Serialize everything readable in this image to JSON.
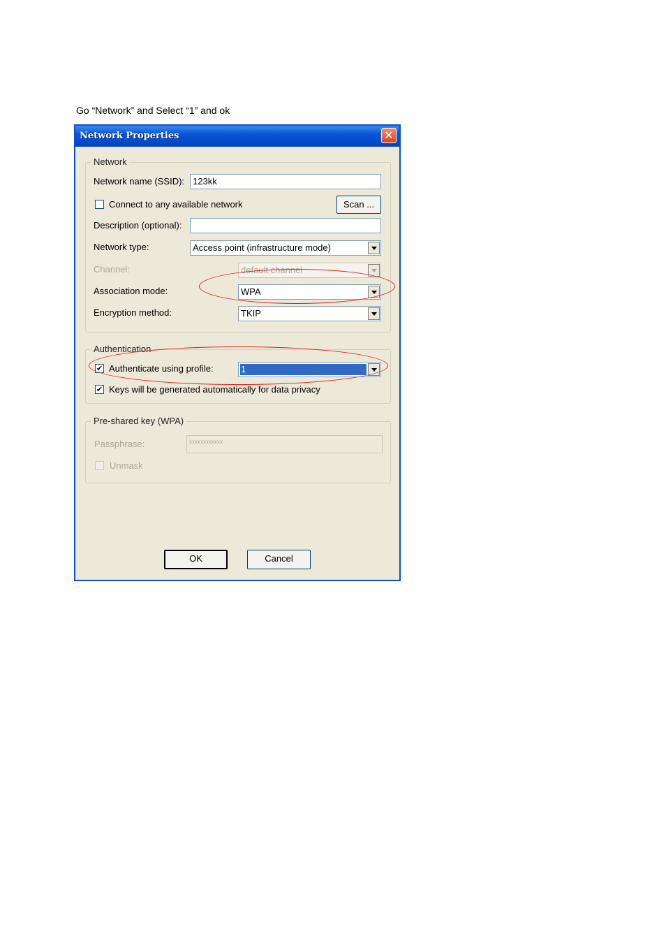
{
  "caption": "Go “Network” and Select “1” and ok",
  "dialog": {
    "title": "Network Properties",
    "close_icon": "close-icon"
  },
  "network_group": {
    "legend": "Network",
    "ssid_label": "Network name (SSID):",
    "ssid_value": "123kk",
    "connect_any_label": "Connect to any available network",
    "connect_any_checked": false,
    "scan_button": "Scan ...",
    "description_label": "Description (optional):",
    "description_value": "",
    "network_type_label": "Network type:",
    "network_type_value": "Access point (infrastructure mode)",
    "channel_label": "Channel:",
    "channel_value": "default channel",
    "association_label": "Association mode:",
    "association_value": "WPA",
    "encryption_label": "Encryption method:",
    "encryption_value": "TKIP"
  },
  "authentication_group": {
    "legend": "Authentication",
    "auth_profile_label": "Authenticate using profile:",
    "auth_profile_checked": true,
    "auth_profile_value": "1",
    "keys_auto_label": "Keys will be generated automatically for data privacy",
    "keys_auto_checked": true
  },
  "psk_group": {
    "legend": "Pre-shared key (WPA)",
    "passphrase_label": "Passphrase:",
    "passphrase_value": "xxxxxxxxxxxx",
    "unmask_label": "Unmask",
    "unmask_checked": false
  },
  "buttons": {
    "ok": "OK",
    "cancel": "Cancel"
  },
  "annotation_color": "#e02020"
}
